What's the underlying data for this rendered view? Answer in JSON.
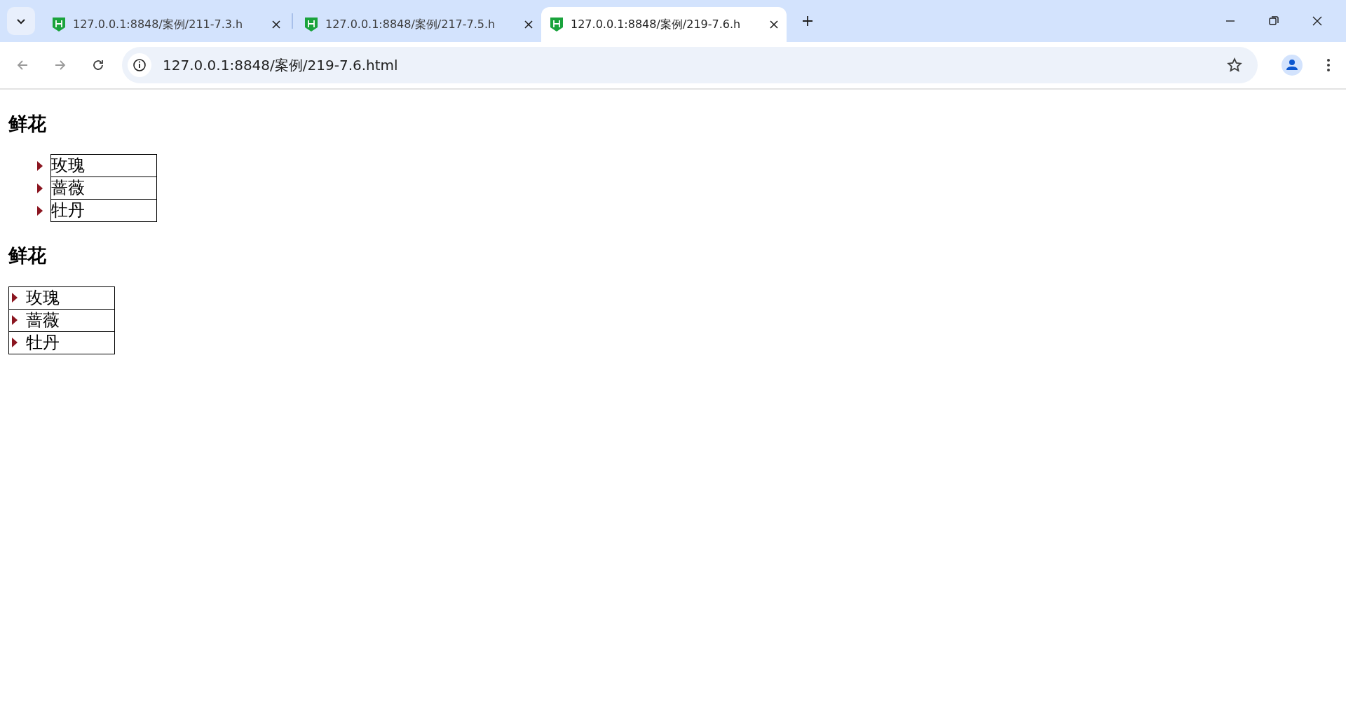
{
  "browser": {
    "tabs": [
      {
        "title": "127.0.0.1:8848/案例/211-7.3.h",
        "selected": false
      },
      {
        "title": "127.0.0.1:8848/案例/217-7.5.h",
        "selected": false
      },
      {
        "title": "127.0.0.1:8848/案例/219-7.6.h",
        "selected": true
      }
    ],
    "address": "127.0.0.1:8848/案例/219-7.6.html"
  },
  "sections": [
    {
      "heading": "鲜花",
      "kind": "outside",
      "items": [
        "玫瑰",
        "蔷薇",
        "牡丹"
      ]
    },
    {
      "heading": "鲜花",
      "kind": "inside",
      "items": [
        "玫瑰",
        "蔷薇",
        "牡丹"
      ]
    }
  ]
}
